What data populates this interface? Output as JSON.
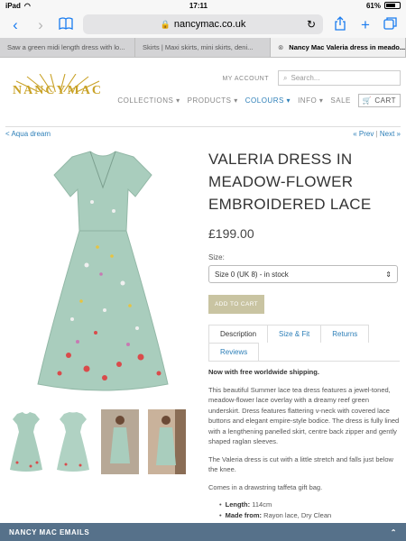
{
  "status": {
    "device": "iPad",
    "time": "17:11",
    "battery": "61%"
  },
  "browser": {
    "url": "nancymac.co.uk",
    "tabs": [
      {
        "label": "Saw a green midi length dress with lo...",
        "active": false
      },
      {
        "label": "Skirts | Maxi skirts, mini skirts, deni...",
        "active": false
      },
      {
        "label": "Nancy Mac Valeria dress in meado...",
        "active": true
      }
    ]
  },
  "header": {
    "logo": "NANCYMAC",
    "my_account": "MY ACCOUNT",
    "search_placeholder": "Search...",
    "nav": [
      {
        "label": "COLLECTIONS",
        "current": false
      },
      {
        "label": "PRODUCTS",
        "current": false
      },
      {
        "label": "COLOURS",
        "current": true
      },
      {
        "label": "INFO",
        "current": false
      },
      {
        "label": "SALE",
        "current": false
      }
    ],
    "cart": "CART"
  },
  "breadcrumb": {
    "back": "< Aqua dream",
    "prev": "« Prev",
    "next": "Next »"
  },
  "product": {
    "title": "VALERIA DRESS IN MEADOW-FLOWER EMBROIDERED LACE",
    "price": "£199.00",
    "size_label": "Size:",
    "size_value": "Size 0 (UK 8) - in stock",
    "add_to_cart": "ADD TO CART",
    "tabs": [
      "Description",
      "Size & Fit",
      "Returns",
      "Reviews"
    ],
    "shipping": "Now with free worldwide shipping.",
    "description": [
      "This beautiful Summer lace tea dress features a jewel-toned, meadow-flower lace overlay with a dreamy reef green underskirt. Dress features flattering v-neck with covered lace buttons and elegant empire-style bodice. The dress is fully lined with a lengthening panelled skirt, centre back zipper and gently shaped raglan sleeves.",
      "The Valeria dress is cut with a little stretch and falls just below the knee.",
      "Comes in a drawstring taffeta gift bag."
    ],
    "specs": [
      {
        "key": "Length:",
        "value": "114cm"
      },
      {
        "key": "Made from:",
        "value": "Rayon lace, Dry Clean"
      }
    ]
  },
  "footer_bar": {
    "label": "NANCY MAC EMAILS",
    "icon": "chevron-up-icon"
  },
  "colors": {
    "accent": "#2d7fb8",
    "gold": "#c9a227",
    "dress": "#a9cdbd",
    "button": "#c9c4a2",
    "bar": "#56718a"
  }
}
